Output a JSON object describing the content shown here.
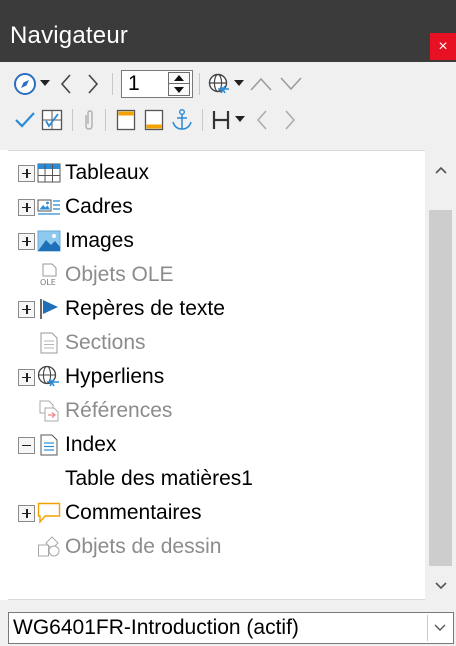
{
  "window": {
    "title": "Navigateur",
    "close_glyph": "×"
  },
  "toolbar": {
    "page_number": "1",
    "row1_icons": [
      "navigate-by-icon",
      "chevron-down-icon",
      "previous-icon",
      "next-icon",
      "page-spin",
      "drag-mode-icon",
      "chevron-down-icon",
      "promote-icon",
      "demote-icon"
    ],
    "row2_icons": [
      "toggle-content-icon",
      "set-reminder-icon",
      "header-icon",
      "footer-icon",
      "anchor-icon",
      "heading-levels-icon",
      "chevron-down-icon",
      "previous-icon",
      "next-icon"
    ],
    "accent_color": "#2a8bd6"
  },
  "tree": {
    "items": [
      {
        "label": "Tableaux",
        "icon": "table-icon",
        "expander": "plus",
        "enabled": true,
        "indent": 0
      },
      {
        "label": "Cadres",
        "icon": "frame-icon",
        "expander": "plus",
        "enabled": true,
        "indent": 0
      },
      {
        "label": "Images",
        "icon": "image-icon",
        "expander": "plus",
        "enabled": true,
        "indent": 0
      },
      {
        "label": "Objets OLE",
        "icon": "ole-object-icon",
        "expander": "none",
        "enabled": false,
        "indent": 0
      },
      {
        "label": "Repères de texte",
        "icon": "bookmark-flag-icon",
        "expander": "plus",
        "enabled": true,
        "indent": 0
      },
      {
        "label": "Sections",
        "icon": "section-icon",
        "expander": "none",
        "enabled": false,
        "indent": 0
      },
      {
        "label": "Hyperliens",
        "icon": "hyperlink-globe-icon",
        "expander": "plus",
        "enabled": true,
        "indent": 0
      },
      {
        "label": "Références",
        "icon": "reference-icon",
        "expander": "none",
        "enabled": false,
        "indent": 0
      },
      {
        "label": "Index",
        "icon": "index-icon",
        "expander": "minus",
        "enabled": true,
        "indent": 0
      },
      {
        "label": "Table des matières1",
        "icon": "",
        "expander": "none",
        "enabled": true,
        "indent": 1
      },
      {
        "label": "Commentaires",
        "icon": "comment-icon",
        "expander": "plus",
        "enabled": true,
        "indent": 0
      },
      {
        "label": "Objets de dessin",
        "icon": "drawing-object-icon",
        "expander": "none",
        "enabled": false,
        "indent": 0
      }
    ]
  },
  "document_select": {
    "value": "WG6401FR-Introduction (actif)"
  }
}
